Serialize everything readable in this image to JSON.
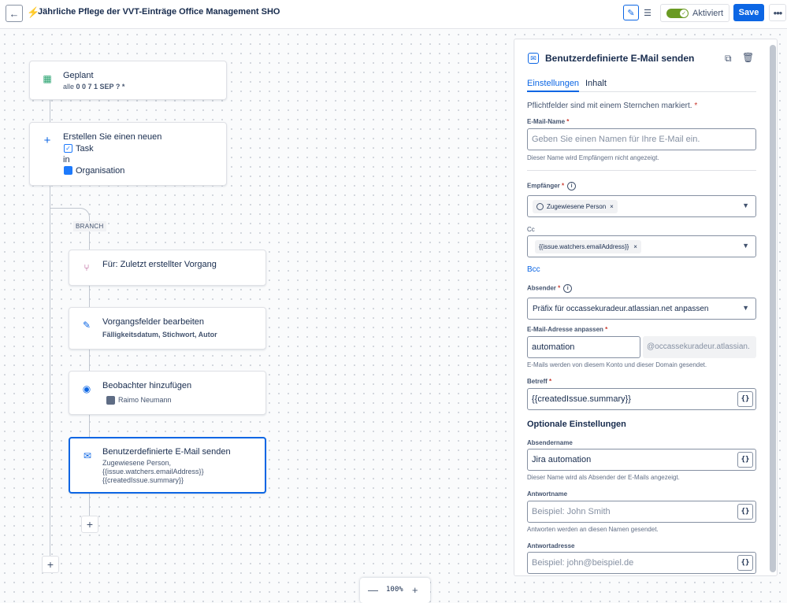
{
  "header": {
    "title": "Jährliche Pflege der VVT-Einträge Office Management SHO",
    "toggle_label": "Aktiviert",
    "save_label": "Save"
  },
  "flow": {
    "trigger": {
      "title": "Geplant",
      "sub_prefix": "alle",
      "sub_value": "0 0 7 1 SEP ? *"
    },
    "create": {
      "title": "Erstellen Sie einen neuen",
      "type": "Task",
      "in": "in",
      "project": "Organisation"
    },
    "branch_label": "BRANCH",
    "branch_card": {
      "title": "Für: Zuletzt erstellter Vorgang"
    },
    "edit_card": {
      "title": "Vorgangsfelder bearbeiten",
      "sub": "Fälligkeitsdatum, Stichwort, Autor"
    },
    "watch_card": {
      "title": "Beobachter hinzufügen",
      "sub": "Raimo Neumann"
    },
    "email_card": {
      "title": "Benutzerdefinierte E-Mail senden",
      "line1": "Zugewiesene Person,",
      "line2": "{{issue.watchers.emailAddress}}",
      "line3": "{{createdIssue.summary}}"
    }
  },
  "zoom": {
    "value": "100%"
  },
  "panel": {
    "title": "Benutzerdefinierte E-Mail senden",
    "tabs": [
      "Einstellungen",
      "Inhalt"
    ],
    "required_note": "Pflichtfelder sind mit einem Sternchen markiert.",
    "email_name": {
      "label": "E-Mail-Name",
      "placeholder": "Geben Sie einen Namen für Ihre E-Mail ein.",
      "help": "Dieser Name wird Empfängern nicht angezeigt."
    },
    "recipients": {
      "label": "Empfänger",
      "chip": "Zugewiesene Person"
    },
    "cc": {
      "label": "Cc",
      "chip": "{{issue.watchers.emailAddress}}"
    },
    "bcc": "Bcc",
    "sender": {
      "label": "Absender",
      "value": "Präfix für occassekuradeur.atlassian.net anpassen"
    },
    "address": {
      "label": "E-Mail-Adresse anpassen",
      "value": "automation",
      "domain": "@occassekuradeur.atlassian.",
      "help": "E-Mails werden von diesem Konto und dieser Domain gesendet."
    },
    "subject": {
      "label": "Betreff",
      "value": "{{createdIssue.summary}}"
    },
    "optional_heading": "Optionale Einstellungen",
    "sender_name": {
      "label": "Absendername",
      "value": "Jira automation",
      "help": "Dieser Name wird als Absender der E-Mails angezeigt."
    },
    "reply_name": {
      "label": "Antwortname",
      "placeholder": "Beispiel: John Smith",
      "help": "Antworten werden an diesen Namen gesendet."
    },
    "reply_address": {
      "label": "Antwortadresse",
      "placeholder": "Beispiel: john@beispiel.de"
    },
    "brace_label": "{}"
  }
}
